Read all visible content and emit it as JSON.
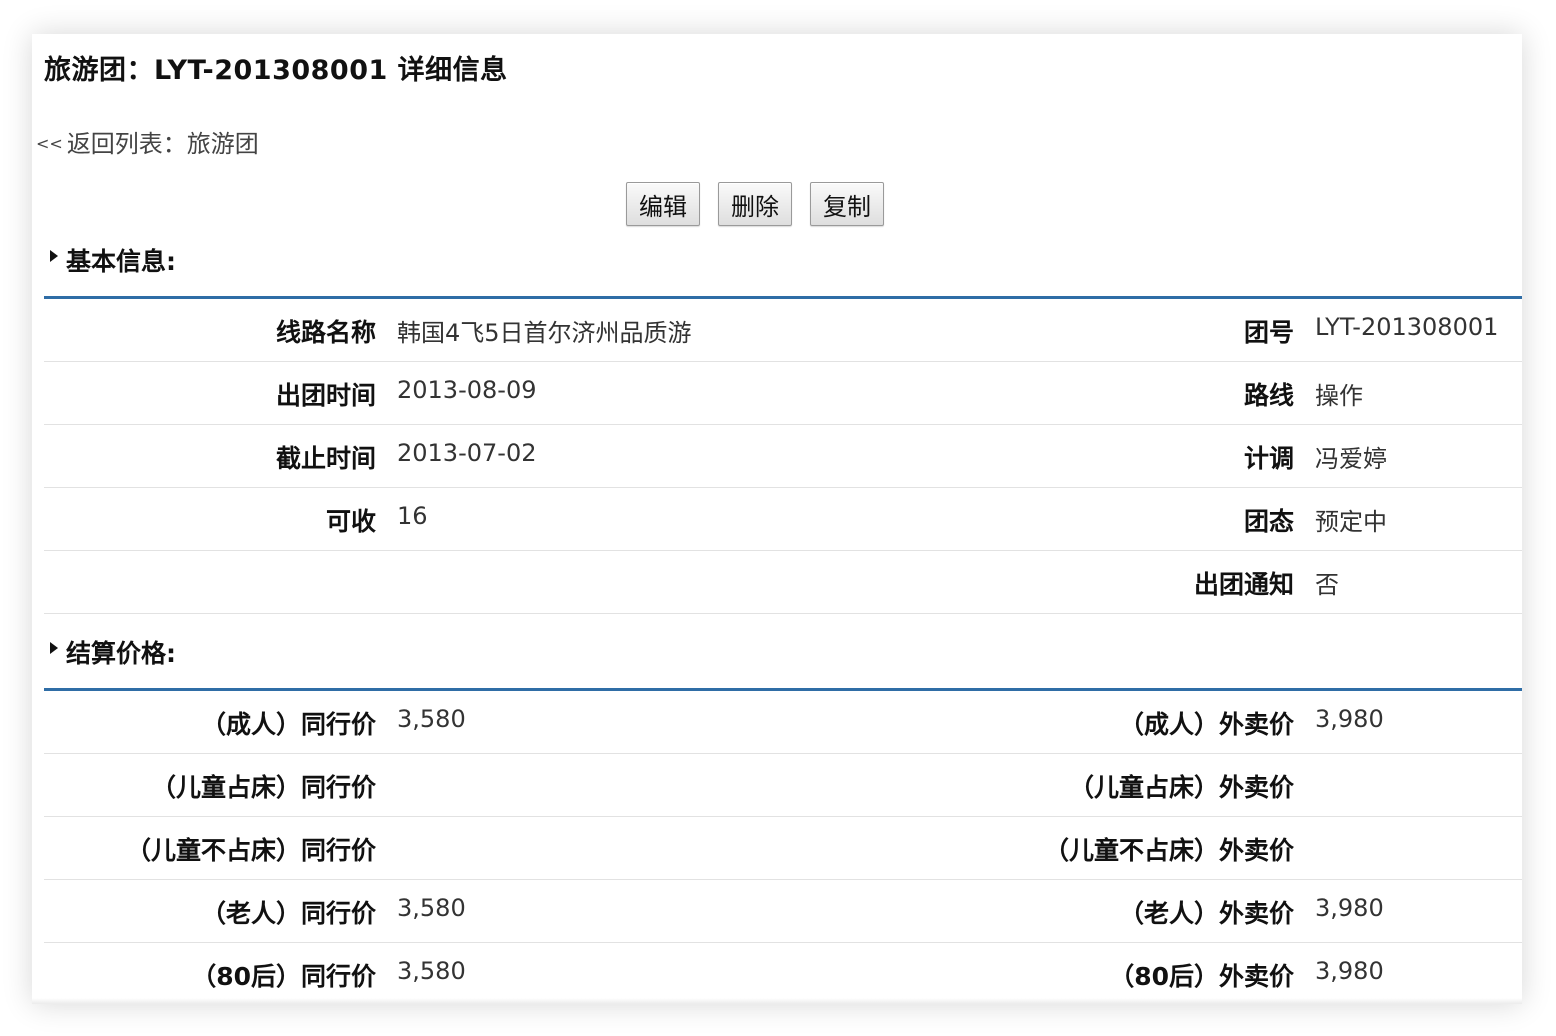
{
  "header": {
    "title": "旅游团：LYT-201308001 详细信息",
    "back_arrows": "<<",
    "back_text": "返回列表：旅游团"
  },
  "toolbar": {
    "edit_label": "编辑",
    "delete_label": "删除",
    "copy_label": "复制"
  },
  "basic": {
    "section_title": "基本信息:",
    "rows": [
      {
        "left_label": "线路名称",
        "left_value": "韩国4飞5日首尔济州品质游",
        "right_label": "团号",
        "right_value": "LYT-201308001"
      },
      {
        "left_label": "出团时间",
        "left_value": "2013-08-09",
        "right_label": "路线",
        "right_value": "操作"
      },
      {
        "left_label": "截止时间",
        "left_value": "2013-07-02",
        "right_label": "计调",
        "right_value": "冯爱婷"
      },
      {
        "left_label": "可收",
        "left_value": "16",
        "right_label": "团态",
        "right_value": "预定中"
      },
      {
        "left_label": "",
        "left_value": "",
        "right_label": "出团通知",
        "right_value": "否"
      }
    ]
  },
  "pricing": {
    "section_title": "结算价格:",
    "rows": [
      {
        "left_label": "（成人）同行价",
        "left_value": "3,580",
        "right_label": "（成人）外卖价",
        "right_value": "3,980"
      },
      {
        "left_label": "（儿童占床）同行价",
        "left_value": "",
        "right_label": "（儿童占床）外卖价",
        "right_value": ""
      },
      {
        "left_label": "（儿童不占床）同行价",
        "left_value": "",
        "right_label": "（儿童不占床）外卖价",
        "right_value": ""
      },
      {
        "left_label": "（老人）同行价",
        "left_value": "3,580",
        "right_label": "（老人）外卖价",
        "right_value": "3,980"
      },
      {
        "left_label": "（80后）同行价",
        "left_value": "3,580",
        "right_label": "（80后）外卖价",
        "right_value": "3,980"
      }
    ]
  },
  "colors": {
    "section_rule": "#2f6da6",
    "row_divider": "#e2e2e2"
  }
}
